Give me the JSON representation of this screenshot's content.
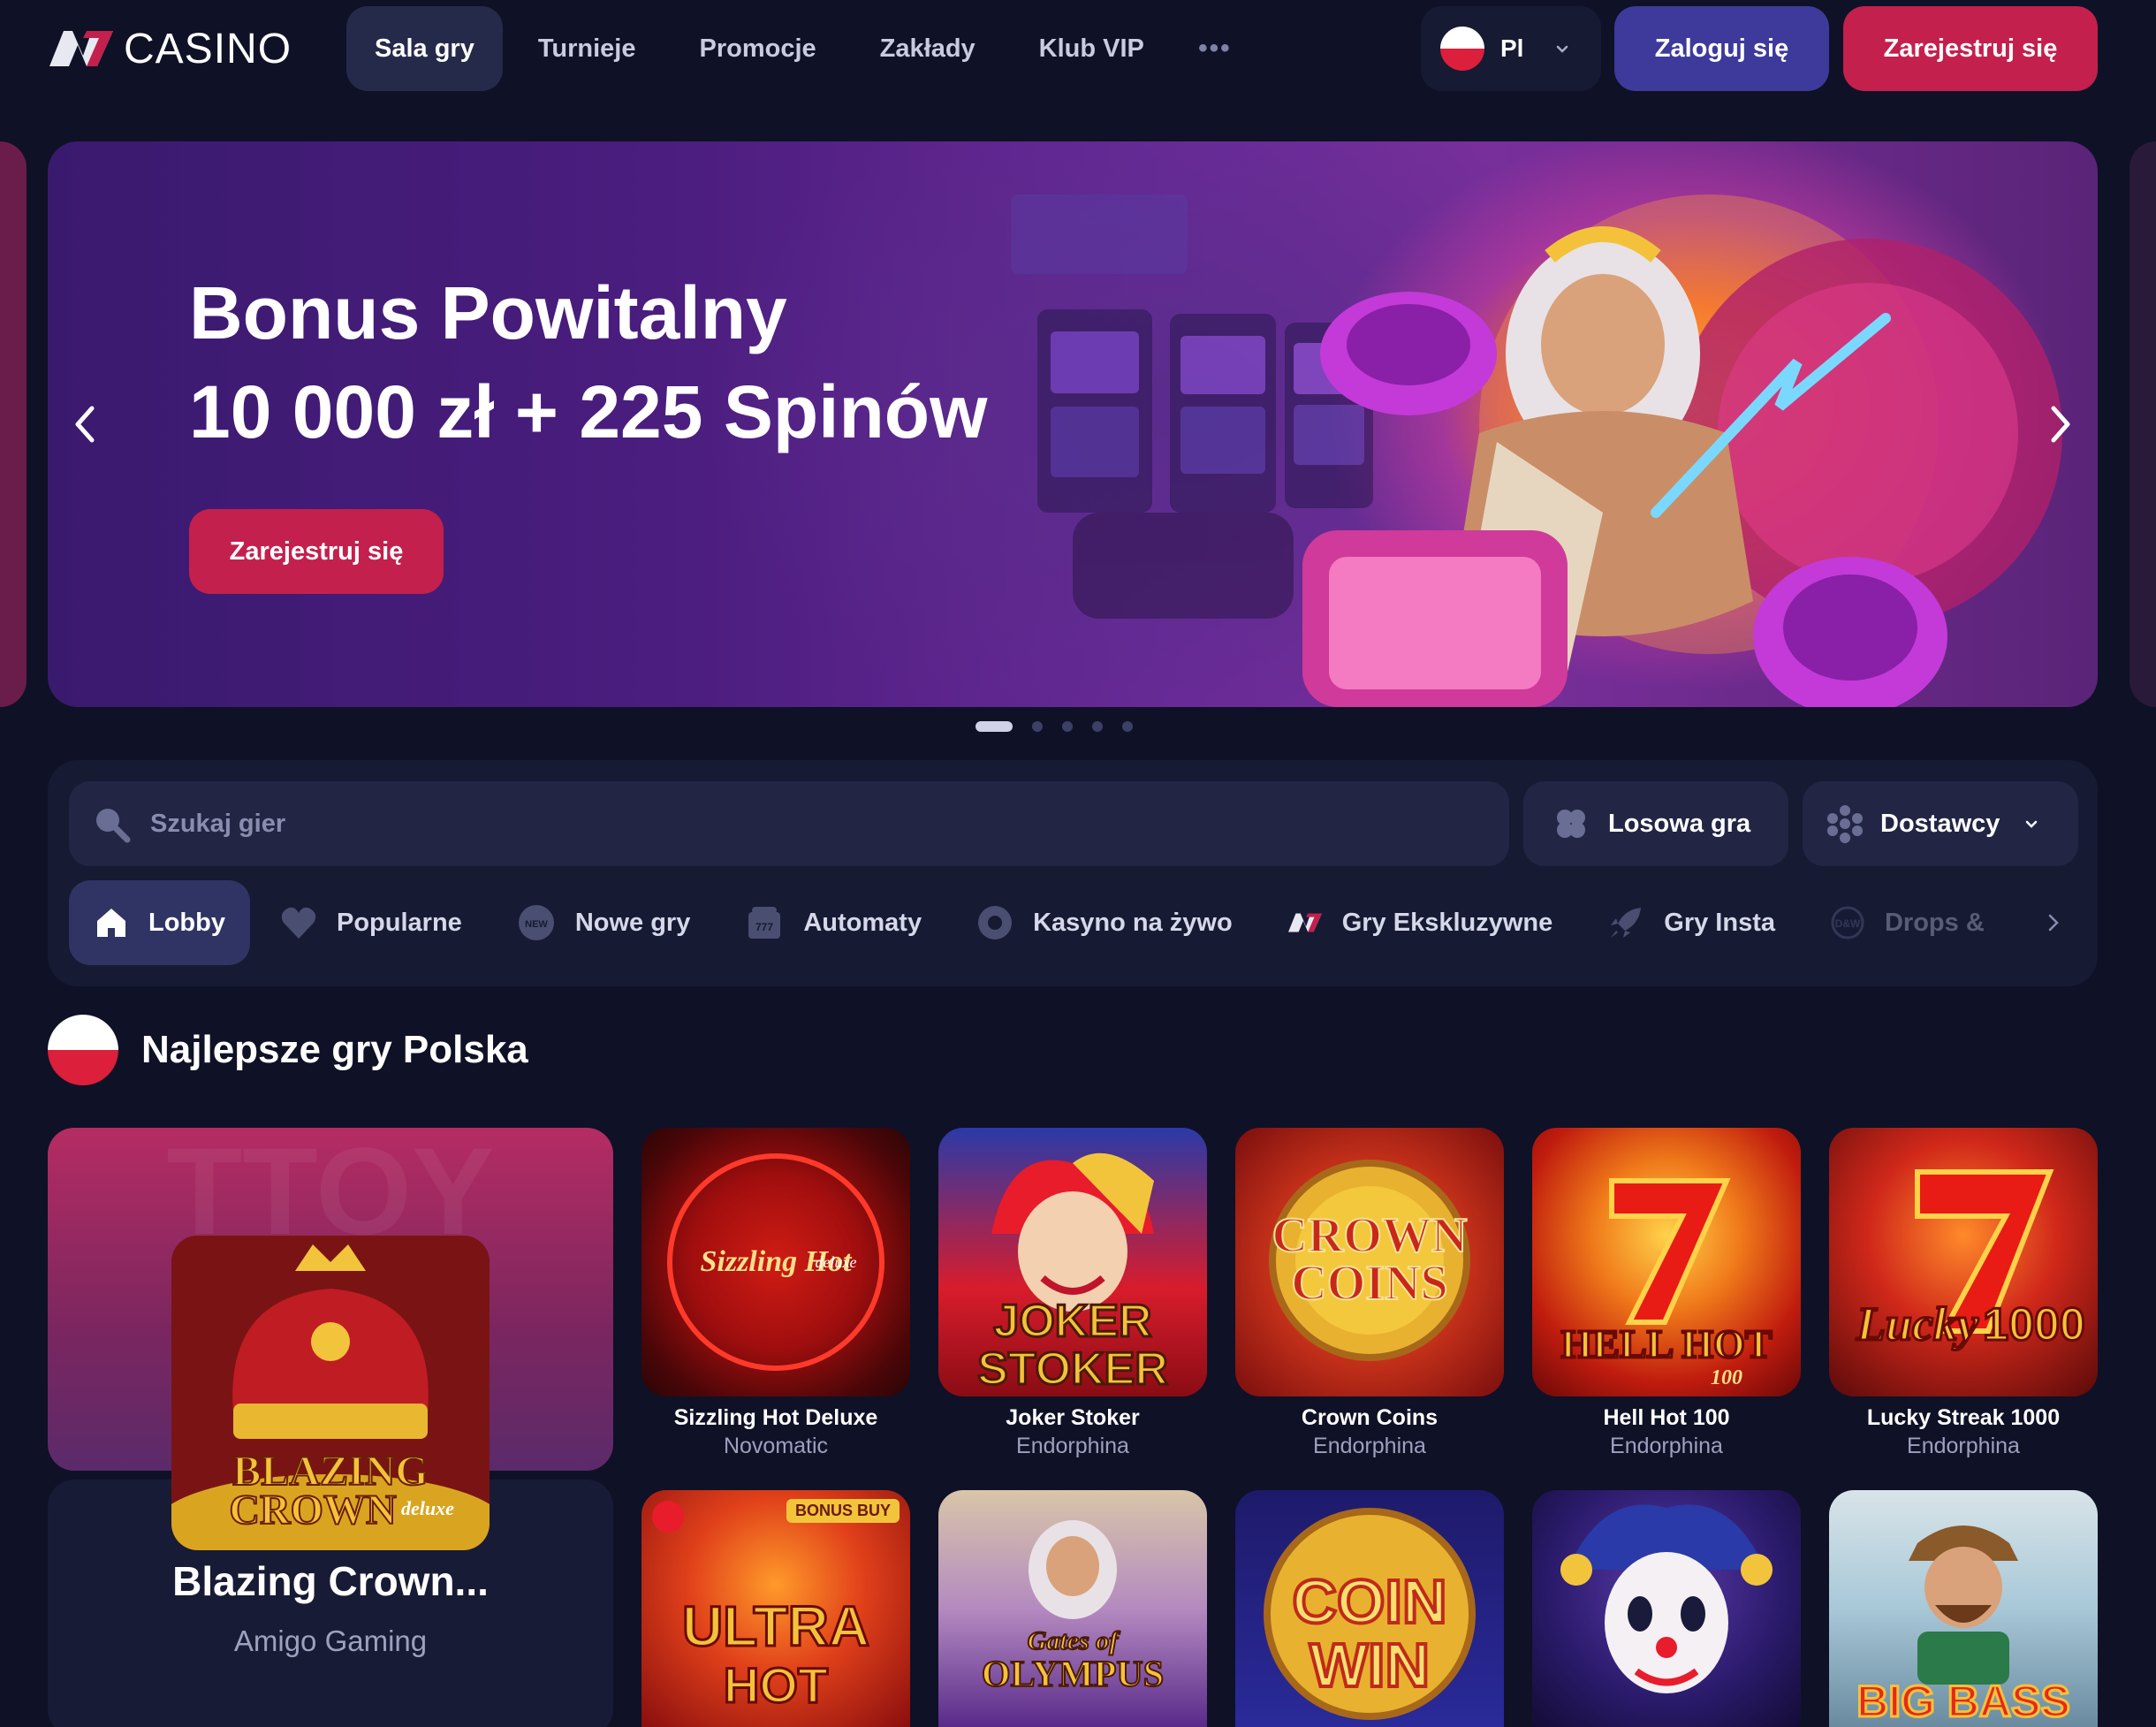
{
  "brand": {
    "logo_text": "CASINO"
  },
  "nav": {
    "items": [
      "Sala gry",
      "Turnieje",
      "Promocje",
      "Zakłady",
      "Klub VIP"
    ],
    "more_label": "•••"
  },
  "header": {
    "language": "Pl",
    "login_label": "Zaloguj się",
    "register_label": "Zarejestruj się"
  },
  "hero": {
    "title_line1": "Bonus Powitalny",
    "title_line2": "10 000 zł + 225 Spinów",
    "cta_label": "Zarejestruj się",
    "slides_count": 5,
    "active_slide": 1
  },
  "filters": {
    "search_placeholder": "Szukaj gier",
    "random_label": "Losowa gra",
    "providers_label": "Dostawcy",
    "categories": [
      {
        "label": "Lobby",
        "icon": "home-icon"
      },
      {
        "label": "Popularne",
        "icon": "heart-icon"
      },
      {
        "label": "Nowe gry",
        "icon": "new-badge-icon"
      },
      {
        "label": "Automaty",
        "icon": "slot-machine-icon"
      },
      {
        "label": "Kasyno na żywo",
        "icon": "live-chip-icon"
      },
      {
        "label": "Gry Ekskluzywne",
        "icon": "brand-icon"
      },
      {
        "label": "Gry Insta",
        "icon": "rocket-icon"
      },
      {
        "label": "Drops &",
        "icon": "drops-icon"
      }
    ]
  },
  "section": {
    "title": "Najlepsze gry Polska",
    "featured": {
      "name": "Blazing Crown...",
      "provider": "Amigo Gaming",
      "art_text_1": "BLAZING",
      "art_text_2": "CROWN",
      "art_text_3": "deluxe"
    },
    "games": [
      {
        "name": "Sizzling Hot Deluxe",
        "provider": "Novomatic",
        "art_text": "Sizzling Hot",
        "art_sub": "deluxe"
      },
      {
        "name": "Joker Stoker",
        "provider": "Endorphina",
        "art_text": "JOKER",
        "art_sub": "STOKER"
      },
      {
        "name": "Crown Coins",
        "provider": "Endorphina",
        "art_text": "CROWN",
        "art_sub": "COINS"
      },
      {
        "name": "Hell Hot 100",
        "provider": "Endorphina",
        "art_text": "HELL HOT",
        "art_sub": "100"
      },
      {
        "name": "Lucky Streak 1000",
        "provider": "Endorphina",
        "art_text": "Lucky",
        "art_sub": "1000"
      }
    ],
    "games_row2": [
      {
        "art_text": "ULTRA",
        "art_sub": "HOT",
        "badge": "BONUS BUY"
      },
      {
        "art_text": "Gates of",
        "art_sub": "OLYMPUS"
      },
      {
        "art_text": "COIN",
        "art_sub": "WIN"
      },
      {
        "art_text": ""
      },
      {
        "art_text": "BIG BASS"
      }
    ]
  },
  "colors": {
    "background": "#0f1126",
    "panel": "#161a33",
    "accent_primary": "#c3204d",
    "accent_secondary": "#3d3a9c"
  }
}
